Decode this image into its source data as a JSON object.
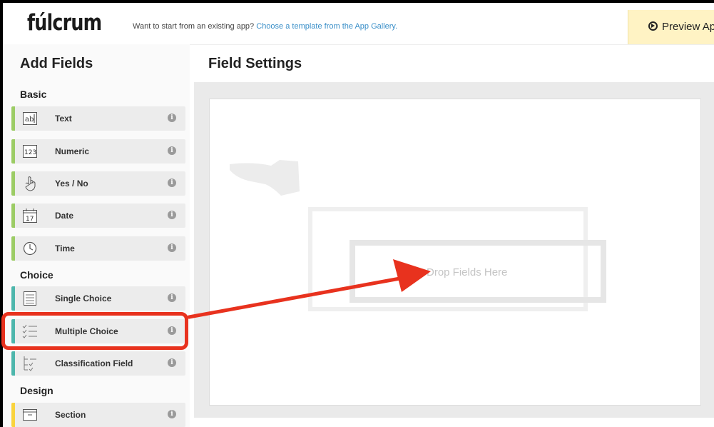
{
  "header": {
    "logo": "fúlcrum",
    "tagline_text": "Want to start from an existing app?",
    "tagline_link": "Choose a template from the App Gallery.",
    "preview_label": "Preview Ap"
  },
  "sidebar": {
    "title": "Add Fields",
    "groups": [
      {
        "title": "Basic",
        "items": [
          {
            "label": "Text",
            "icon": "text-field-icon"
          },
          {
            "label": "Numeric",
            "icon": "numeric-field-icon"
          },
          {
            "label": "Yes / No",
            "icon": "hand-pointer-icon"
          },
          {
            "label": "Date",
            "icon": "calendar-icon"
          },
          {
            "label": "Time",
            "icon": "clock-icon"
          }
        ]
      },
      {
        "title": "Choice",
        "items": [
          {
            "label": "Single Choice",
            "icon": "single-choice-list-icon"
          },
          {
            "label": "Multiple Choice",
            "icon": "multiple-choice-checklist-icon"
          },
          {
            "label": "Classification Field",
            "icon": "classification-tree-icon"
          }
        ]
      },
      {
        "title": "Design",
        "items": [
          {
            "label": "Section",
            "icon": "section-box-icon"
          }
        ]
      }
    ],
    "info_glyph": "i"
  },
  "main": {
    "title": "Field Settings",
    "drop_text": "Drop Fields Here"
  },
  "colors": {
    "basic_accent": "#9ccc65",
    "choice_accent": "#4db6ac",
    "design_accent": "#f9d33d",
    "annotation": "#e8321e",
    "preview_bg": "#fff3c4",
    "link": "#3a8fc8"
  }
}
